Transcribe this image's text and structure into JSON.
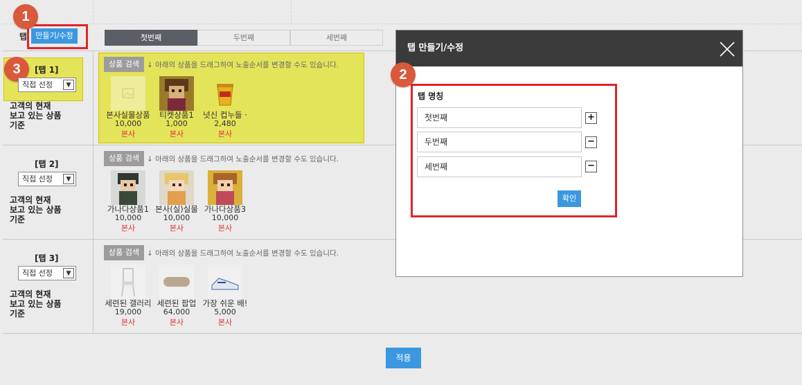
{
  "header": {
    "tab_label": "탭",
    "make_edit_button": "만들기/수정"
  },
  "badges": [
    "1",
    "2",
    "3"
  ],
  "tabbar": [
    "첫번째",
    "두번째",
    "세번째"
  ],
  "rows": [
    {
      "title": "[탭 1]",
      "select_value": "직접 선정",
      "desc": [
        "고객의 현재",
        "보고 있는 상품",
        "기준"
      ],
      "search_button": "상품 검색",
      "hint": "↓ 아래의 상품을 드래그하여 노출순서를 변경할 수도 있습니다.",
      "products": [
        {
          "name": "본사실물상품",
          "price": "10,000",
          "seller": "본사",
          "icon": "placeholder-image-icon"
        },
        {
          "name": "티켓상품1",
          "price": "1,000",
          "seller": "본사",
          "icon": "pixel-character-icon"
        },
        {
          "name": "넛신 컵누들 ·",
          "price": "2,480",
          "seller": "본사",
          "icon": "cup-noodle-icon"
        }
      ]
    },
    {
      "title": "[탭 2]",
      "select_value": "직접 선정",
      "desc": [
        "고객의 현재",
        "보고 있는 상품",
        "기준"
      ],
      "search_button": "상품 검색",
      "hint": "↓ 아래의 상품을 드래그하여 노출순서를 변경할 수도 있습니다.",
      "products": [
        {
          "name": "가나다상품1",
          "price": "10,000",
          "seller": "본사",
          "icon": "pixel-character-icon"
        },
        {
          "name": "본사(실)실물",
          "price": "10,000",
          "seller": "본사",
          "icon": "pixel-character-icon"
        },
        {
          "name": "가나다상품3",
          "price": "10,000",
          "seller": "본사",
          "icon": "pixel-character-icon"
        }
      ]
    },
    {
      "title": "[탭 3]",
      "select_value": "직접 선정",
      "desc": [
        "고객의 현재",
        "보고 있는 상품",
        "기준"
      ],
      "search_button": "상품 검색",
      "hint": "↓ 아래의 상품을 드래그하여 노출순서를 변경할 수도 있습니다.",
      "products": [
        {
          "name": "세련된 갤러리",
          "price": "19,000",
          "seller": "본사",
          "icon": "chair-icon"
        },
        {
          "name": "세련된 팝업",
          "price": "64,000",
          "seller": "본사",
          "icon": "pillow-icon"
        },
        {
          "name": "가장 쉬운 배!",
          "price": "5,000",
          "seller": "본사",
          "icon": "sneaker-icon"
        }
      ]
    }
  ],
  "apply_button": "적용",
  "modal": {
    "title": "탭 만들기/수정",
    "section_label": "탭 명칭",
    "fields": [
      "첫번째",
      "두번째",
      "세번째"
    ],
    "confirm_button": "확인"
  },
  "colors": {
    "accent_blue": "#3b98e0",
    "highlight_yellow": "#e4e45a",
    "badge_orange": "#d9593a",
    "red_outline": "#e0242b",
    "seller_red": "#e03232"
  }
}
